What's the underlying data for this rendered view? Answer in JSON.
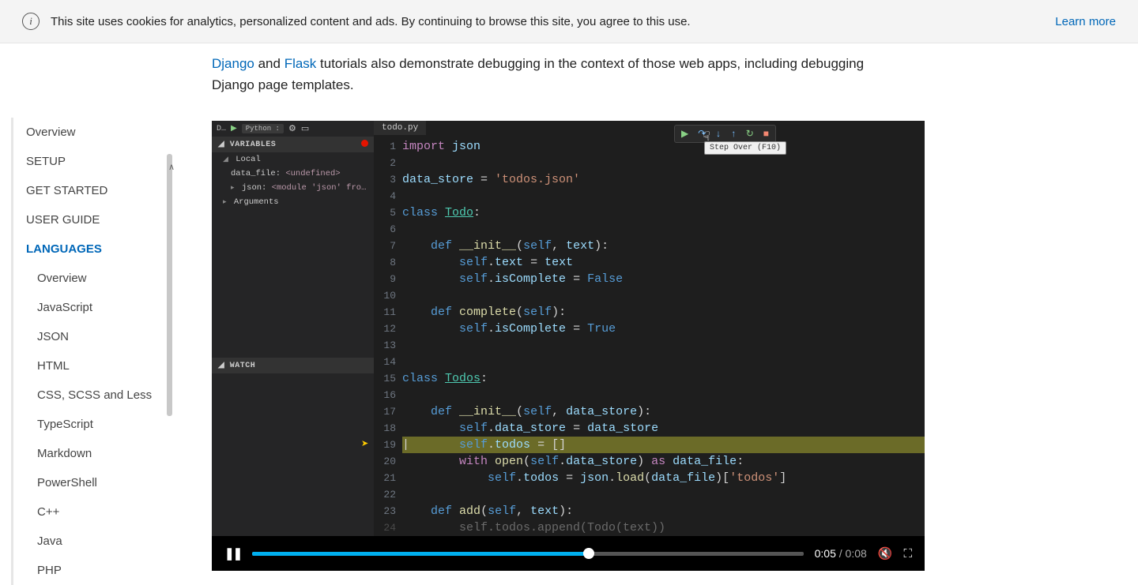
{
  "cookie": {
    "text": "This site uses cookies for analytics, personalized content and ads. By continuing to browse this site, you agree to this use.",
    "learn": "Learn more"
  },
  "intro": {
    "django": "Django",
    "and": " and ",
    "flask": "Flask",
    "rest": " tutorials also demonstrate debugging in the context of those web apps, including debugging Django page templates."
  },
  "sidebar": {
    "items": [
      "Overview",
      "SETUP",
      "GET STARTED",
      "USER GUIDE",
      "LANGUAGES"
    ],
    "langs": [
      "Overview",
      "JavaScript",
      "JSON",
      "HTML",
      "CSS, SCSS and Less",
      "TypeScript",
      "Markdown",
      "PowerShell",
      "C++",
      "Java",
      "PHP"
    ]
  },
  "vscode": {
    "top_d": "D…",
    "top_chip": "Python :",
    "tab": "todo.py",
    "variables": "VARIABLES",
    "local": "Local",
    "var_datafile": "data_file: ",
    "var_datafile_v": "<undefined>",
    "var_json": "json: ",
    "var_json_v": "<module 'json' fro…",
    "arguments": "Arguments",
    "watch": "WATCH"
  },
  "tooltip": "Step Over (F10)",
  "code": {
    "lines_count": 24
  },
  "video": {
    "current": "0:05",
    "total": "0:08"
  }
}
